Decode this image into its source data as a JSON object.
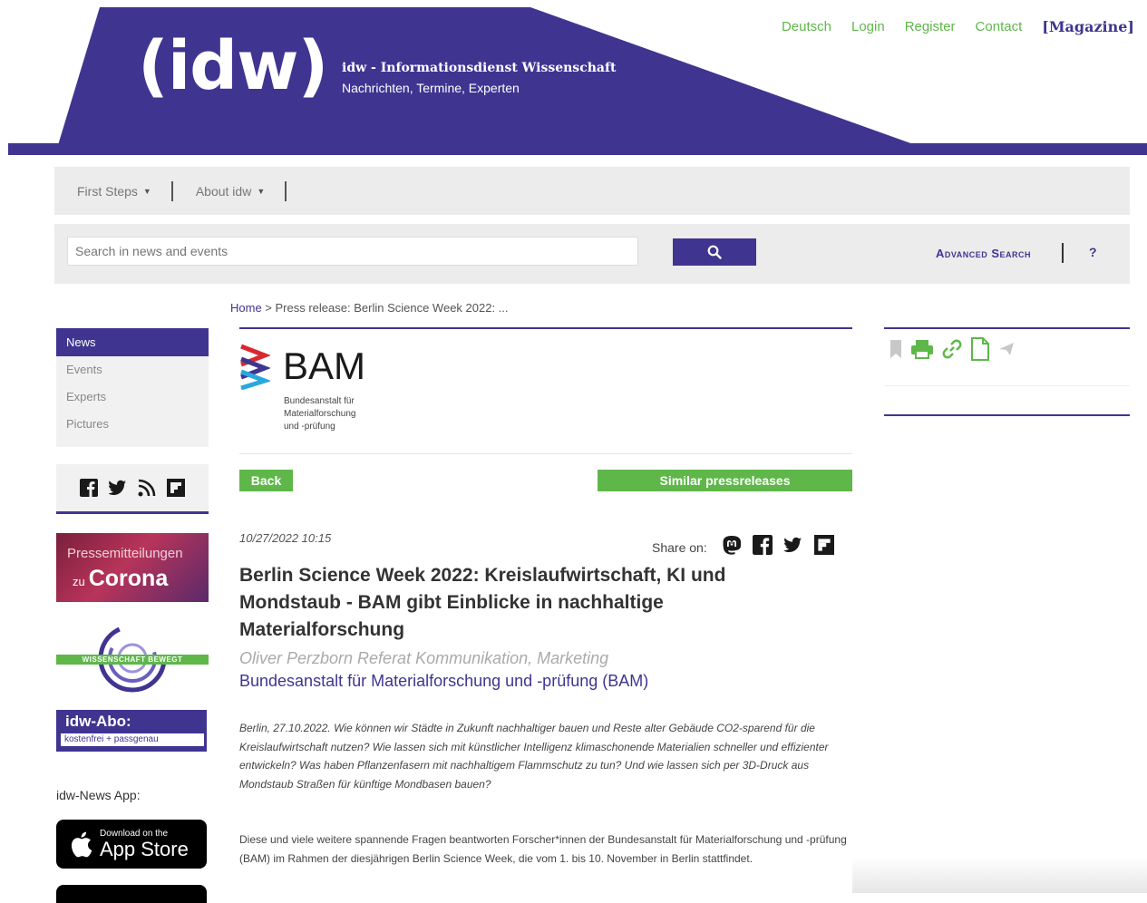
{
  "header": {
    "logo": "(idw)",
    "tagline_title": "idw - Informationsdienst Wissenschaft",
    "tagline_sub": "Nachrichten, Termine, Experten",
    "nav": [
      "Deutsch",
      "Login",
      "Register",
      "Contact"
    ],
    "magazine": "[Magazine]",
    "brand_color": "#3f3591",
    "accent_green": "#5fb74a"
  },
  "menu": {
    "first_steps": "First Steps",
    "about": "About idw"
  },
  "search": {
    "placeholder": "Search in news and events",
    "advanced": "Advanced Search",
    "help": "?"
  },
  "breadcrumb": {
    "home": "Home",
    "separator": " > ",
    "current": "Press release: Berlin Science Week 2022: ..."
  },
  "sidebar": {
    "nav": [
      "News",
      "Events",
      "Experts",
      "Pictures"
    ],
    "corona_line1": "Pressemitteilungen",
    "corona_small": "zu",
    "corona_big": "Corona",
    "wissen_band": "WISSENSCHAFT BEWEGT",
    "abo_title": "idw-Abo:",
    "abo_sub": "kostenfrei + passgenau",
    "app_label": "idw-News App:",
    "appstore_small": "Download on the",
    "appstore_big": "App Store"
  },
  "article": {
    "bam_name": "BAM",
    "bam_sub": [
      "Bundesanstalt für",
      "Materialforschung",
      "und -prüfung"
    ],
    "back": "Back",
    "similar": "Similar pressreleases",
    "date": "10/27/2022 10:15",
    "share_label": "Share on:",
    "title": "Berlin Science Week 2022: Kreislaufwirtschaft, KI und Mondstaub - BAM gibt Einblicke in nachhaltige Materialforschung",
    "author": "Oliver Perzborn Referat Kommunikation, Marketing",
    "institution": "Bundesanstalt für Materialforschung und -prüfung (BAM)",
    "lead": "Berlin, 27.10.2022. Wie können wir Städte in Zukunft nachhaltiger bauen und Reste alter Gebäude CO2-sparend für die Kreislaufwirtschaft nutzen? Wie lassen sich mit künstlicher Intelligenz klimaschonende Materialien schneller und effizienter entwickeln? Was haben Pflanzenfasern mit nachhaltigem Flammschutz zu tun? Und wie lassen sich per 3D-Druck aus Mondstaub Straßen für künftige Mondbasen bauen?",
    "body": "Diese und viele weitere spannende Fragen beantworten Forscher*innen der Bundesanstalt für Materialforschung und -prüfung (BAM) im Rahmen der diesjährigen Berlin Science Week, die vom 1. bis 10. November in Berlin stattfindet."
  }
}
